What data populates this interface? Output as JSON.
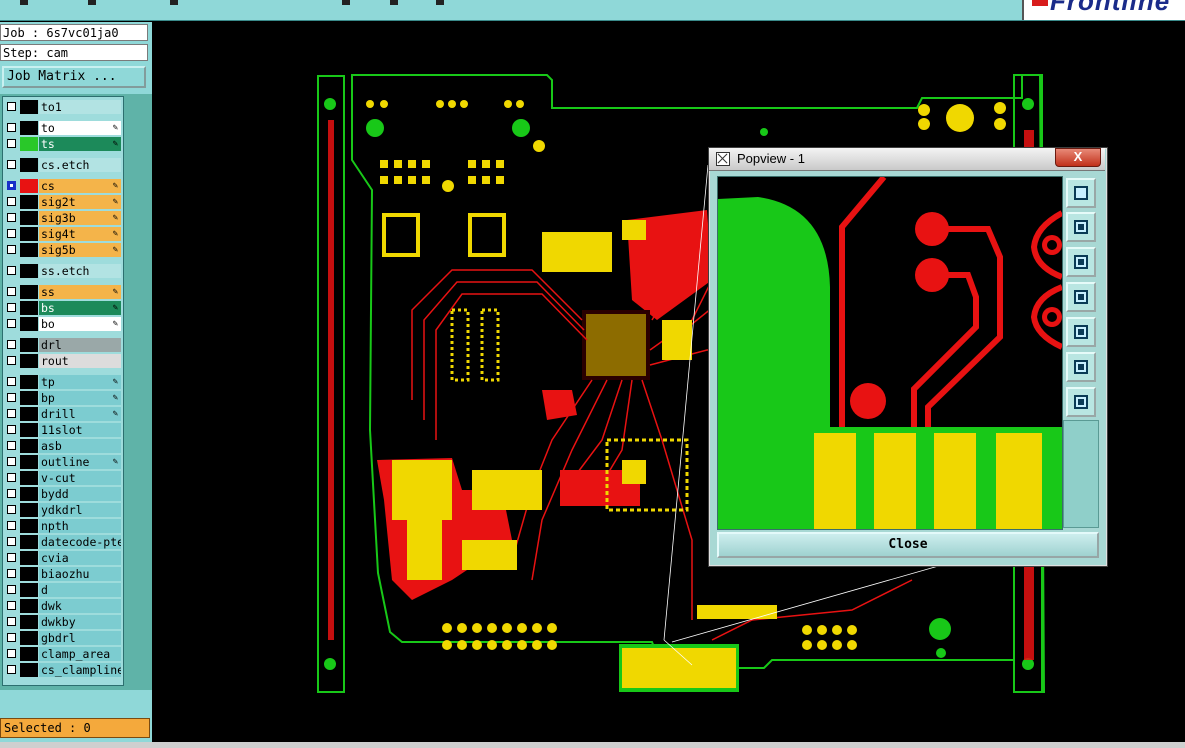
{
  "app": {
    "job_label": "Job : 6s7vc01ja0",
    "step_label": "Step: cam",
    "job_matrix_button": "Job Matrix ...",
    "logo_text": "Frontline",
    "selected_status": "Selected : 0"
  },
  "layers": [
    {
      "name": "to1",
      "checked": false,
      "swatch": "#000000",
      "bg": "#b2e3e3",
      "editable": false,
      "gap_before": false
    },
    {
      "name": "to",
      "checked": false,
      "swatch": "#000000",
      "bg": "#ffffff",
      "editable": true,
      "gap_before": true
    },
    {
      "name": "ts",
      "checked": false,
      "swatch": "#29c829",
      "bg": "#1c8a5a",
      "editable": true,
      "gap_before": false
    },
    {
      "name": "cs.etch",
      "checked": false,
      "swatch": "#000000",
      "bg": "#b2e3e3",
      "editable": false,
      "gap_before": true
    },
    {
      "name": "cs",
      "checked": true,
      "swatch": "#e81212",
      "bg": "#f4b44a",
      "editable": true,
      "gap_before": true
    },
    {
      "name": "sig2t",
      "checked": false,
      "swatch": "#000000",
      "bg": "#f4b44a",
      "editable": true,
      "gap_before": false
    },
    {
      "name": "sig3b",
      "checked": false,
      "swatch": "#000000",
      "bg": "#f4b44a",
      "editable": true,
      "gap_before": false
    },
    {
      "name": "sig4t",
      "checked": false,
      "swatch": "#000000",
      "bg": "#f4b44a",
      "editable": true,
      "gap_before": false
    },
    {
      "name": "sig5b",
      "checked": false,
      "swatch": "#000000",
      "bg": "#f4b44a",
      "editable": true,
      "gap_before": false
    },
    {
      "name": "ss.etch",
      "checked": false,
      "swatch": "#000000",
      "bg": "#b2e3e3",
      "editable": false,
      "gap_before": true
    },
    {
      "name": "ss",
      "checked": false,
      "swatch": "#000000",
      "bg": "#f4b44a",
      "editable": true,
      "gap_before": true
    },
    {
      "name": "bs",
      "checked": false,
      "swatch": "#000000",
      "bg": "#1c8a5a",
      "editable": true,
      "gap_before": false
    },
    {
      "name": "bo",
      "checked": false,
      "swatch": "#000000",
      "bg": "#ffffff",
      "editable": true,
      "gap_before": false
    },
    {
      "name": "drl",
      "checked": false,
      "swatch": "#000000",
      "bg": "#9aa8a8",
      "editable": false,
      "gap_before": true
    },
    {
      "name": "rout",
      "checked": false,
      "swatch": "#000000",
      "bg": "#dcdcdc",
      "editable": false,
      "gap_before": false
    },
    {
      "name": "tp",
      "checked": false,
      "swatch": "#000000",
      "bg": "#7cccd0",
      "editable": true,
      "gap_before": true
    },
    {
      "name": "bp",
      "checked": false,
      "swatch": "#000000",
      "bg": "#7cccd0",
      "editable": true,
      "gap_before": false
    },
    {
      "name": "drill",
      "checked": false,
      "swatch": "#000000",
      "bg": "#7cccd0",
      "editable": true,
      "gap_before": false
    },
    {
      "name": "11slot",
      "checked": false,
      "swatch": "#000000",
      "bg": "#7cccd0",
      "editable": false,
      "gap_before": false
    },
    {
      "name": "asb",
      "checked": false,
      "swatch": "#000000",
      "bg": "#7cccd0",
      "editable": false,
      "gap_before": false
    },
    {
      "name": "outline",
      "checked": false,
      "swatch": "#000000",
      "bg": "#7cccd0",
      "editable": true,
      "gap_before": false
    },
    {
      "name": "v-cut",
      "checked": false,
      "swatch": "#000000",
      "bg": "#7cccd0",
      "editable": false,
      "gap_before": false
    },
    {
      "name": "bydd",
      "checked": false,
      "swatch": "#000000",
      "bg": "#7cccd0",
      "editable": false,
      "gap_before": false
    },
    {
      "name": "ydkdrl",
      "checked": false,
      "swatch": "#000000",
      "bg": "#7cccd0",
      "editable": false,
      "gap_before": false
    },
    {
      "name": "npth",
      "checked": false,
      "swatch": "#000000",
      "bg": "#7cccd0",
      "editable": false,
      "gap_before": false
    },
    {
      "name": "datecode-pte",
      "checked": false,
      "swatch": "#000000",
      "bg": "#7cccd0",
      "editable": false,
      "gap_before": false
    },
    {
      "name": "cvia",
      "checked": false,
      "swatch": "#000000",
      "bg": "#7cccd0",
      "editable": false,
      "gap_before": false
    },
    {
      "name": "biaozhu",
      "checked": false,
      "swatch": "#000000",
      "bg": "#7cccd0",
      "editable": false,
      "gap_before": false
    },
    {
      "name": "d",
      "checked": false,
      "swatch": "#000000",
      "bg": "#7cccd0",
      "editable": false,
      "gap_before": false
    },
    {
      "name": "dwk",
      "checked": false,
      "swatch": "#000000",
      "bg": "#7cccd0",
      "editable": false,
      "gap_before": false
    },
    {
      "name": "dwkby",
      "checked": false,
      "swatch": "#000000",
      "bg": "#7cccd0",
      "editable": false,
      "gap_before": false
    },
    {
      "name": "gbdrl",
      "checked": false,
      "swatch": "#000000",
      "bg": "#7cccd0",
      "editable": false,
      "gap_before": false
    },
    {
      "name": "clamp_area",
      "checked": false,
      "swatch": "#000000",
      "bg": "#7cccd0",
      "editable": false,
      "gap_before": false
    },
    {
      "name": "cs_clampline",
      "checked": false,
      "swatch": "#000000",
      "bg": "#7cccd0",
      "editable": false,
      "gap_before": false
    }
  ],
  "popview": {
    "title": "Popview - 1",
    "close_x": "X",
    "close_button": "Close",
    "tool_icons": [
      "zoom-home-icon",
      "pan-up-icon",
      "pan-down-icon",
      "pan-left-icon",
      "pan-right-icon",
      "zoom-in-icon",
      "zoom-out-icon"
    ]
  },
  "colors": {
    "panel": "#8fd8d8",
    "copper_red": "#e81212",
    "pad_yellow": "#f0d800",
    "mask_green": "#18c818"
  }
}
